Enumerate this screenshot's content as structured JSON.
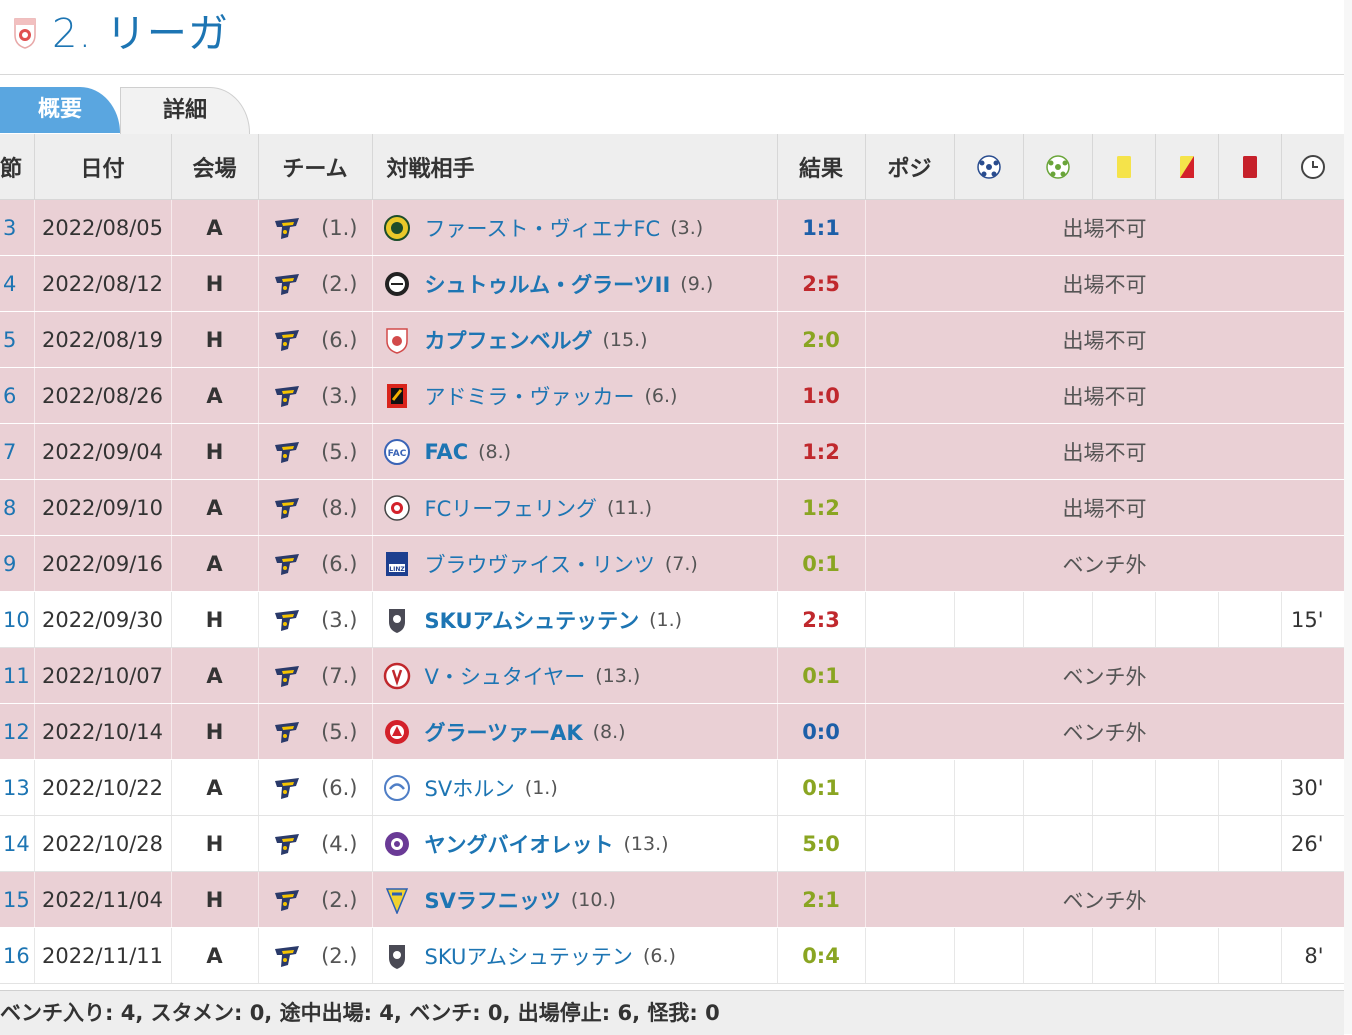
{
  "competition": {
    "title": "2. リーガ"
  },
  "tabs": {
    "overview": "概要",
    "details": "詳細"
  },
  "headers": {
    "round": "節",
    "date": "日付",
    "venue": "会場",
    "team": "チーム",
    "opponent": "対戦相手",
    "result": "結果",
    "position": "ポジ"
  },
  "colors": {
    "accent": "#1d75b3",
    "tab_active": "#5aa6e0",
    "row_unavailable": "#ead0d5",
    "win": "#8aa522",
    "loss": "#c0282d",
    "draw": "#1d5fa8"
  },
  "rows": [
    {
      "round": "3",
      "date": "2022/08/05",
      "venue": "A",
      "team_rank": "(1.)",
      "opponent": "ファースト・ヴィエナFC",
      "opp_rank": "(3.)",
      "bold": false,
      "result": "1:1",
      "res": "draw",
      "status": "出場不可",
      "minutes": "",
      "icon": "vienna-icon"
    },
    {
      "round": "4",
      "date": "2022/08/12",
      "venue": "H",
      "team_rank": "(2.)",
      "opponent": "シュトゥルム・グラーツII",
      "opp_rank": "(9.)",
      "bold": true,
      "result": "2:5",
      "res": "loss",
      "status": "出場不可",
      "minutes": "",
      "icon": "sturm-icon"
    },
    {
      "round": "5",
      "date": "2022/08/19",
      "venue": "H",
      "team_rank": "(6.)",
      "opponent": "カプフェンベルグ",
      "opp_rank": "(15.)",
      "bold": true,
      "result": "2:0",
      "res": "win",
      "status": "出場不可",
      "minutes": "",
      "icon": "kapfenberg-icon"
    },
    {
      "round": "6",
      "date": "2022/08/26",
      "venue": "A",
      "team_rank": "(3.)",
      "opponent": "アドミラ・ヴァッカー",
      "opp_rank": "(6.)",
      "bold": false,
      "result": "1:0",
      "res": "loss",
      "status": "出場不可",
      "minutes": "",
      "icon": "admira-icon"
    },
    {
      "round": "7",
      "date": "2022/09/04",
      "venue": "H",
      "team_rank": "(5.)",
      "opponent": "FAC",
      "opp_rank": "(8.)",
      "bold": true,
      "result": "1:2",
      "res": "loss",
      "status": "出場不可",
      "minutes": "",
      "icon": "fac-icon"
    },
    {
      "round": "8",
      "date": "2022/09/10",
      "venue": "A",
      "team_rank": "(8.)",
      "opponent": "FCリーフェリング",
      "opp_rank": "(11.)",
      "bold": false,
      "result": "1:2",
      "res": "win",
      "status": "出場不可",
      "minutes": "",
      "icon": "liefering-icon"
    },
    {
      "round": "9",
      "date": "2022/09/16",
      "venue": "A",
      "team_rank": "(6.)",
      "opponent": "ブラウヴァイス・リンツ",
      "opp_rank": "(7.)",
      "bold": false,
      "result": "0:1",
      "res": "win",
      "status": "ベンチ外",
      "minutes": "",
      "icon": "linz-icon"
    },
    {
      "round": "10",
      "date": "2022/09/30",
      "venue": "H",
      "team_rank": "(3.)",
      "opponent": "SKUアムシュテッテン",
      "opp_rank": "(1.)",
      "bold": true,
      "result": "2:3",
      "res": "loss",
      "status": "",
      "minutes": "15'",
      "icon": "amstetten-icon"
    },
    {
      "round": "11",
      "date": "2022/10/07",
      "venue": "A",
      "team_rank": "(7.)",
      "opponent": "V・シュタイヤー",
      "opp_rank": "(13.)",
      "bold": false,
      "result": "0:1",
      "res": "win",
      "status": "ベンチ外",
      "minutes": "",
      "icon": "steyr-icon"
    },
    {
      "round": "12",
      "date": "2022/10/14",
      "venue": "H",
      "team_rank": "(5.)",
      "opponent": "グラーツァーAK",
      "opp_rank": "(8.)",
      "bold": true,
      "result": "0:0",
      "res": "draw",
      "status": "ベンチ外",
      "minutes": "",
      "icon": "gak-icon"
    },
    {
      "round": "13",
      "date": "2022/10/22",
      "venue": "A",
      "team_rank": "(6.)",
      "opponent": "SVホルン",
      "opp_rank": "(1.)",
      "bold": false,
      "result": "0:1",
      "res": "win",
      "status": "",
      "minutes": "30'",
      "icon": "horn-icon"
    },
    {
      "round": "14",
      "date": "2022/10/28",
      "venue": "H",
      "team_rank": "(4.)",
      "opponent": "ヤングバイオレット",
      "opp_rank": "(13.)",
      "bold": true,
      "result": "5:0",
      "res": "win",
      "status": "",
      "minutes": "26'",
      "icon": "violets-icon"
    },
    {
      "round": "15",
      "date": "2022/11/04",
      "venue": "H",
      "team_rank": "(2.)",
      "opponent": "SVラフニッツ",
      "opp_rank": "(10.)",
      "bold": true,
      "result": "2:1",
      "res": "win",
      "status": "ベンチ外",
      "minutes": "",
      "icon": "lafnitz-icon"
    },
    {
      "round": "16",
      "date": "2022/11/11",
      "venue": "A",
      "team_rank": "(2.)",
      "opponent": "SKUアムシュテッテン",
      "opp_rank": "(6.)",
      "bold": false,
      "result": "0:4",
      "res": "win",
      "status": "",
      "minutes": "8'",
      "icon": "amstetten-icon"
    }
  ],
  "summary": "ベンチ入り: 4, スタメン: 0, 途中出場: 4, ベンチ: 0, 出場停止: 6, 怪我: 0"
}
